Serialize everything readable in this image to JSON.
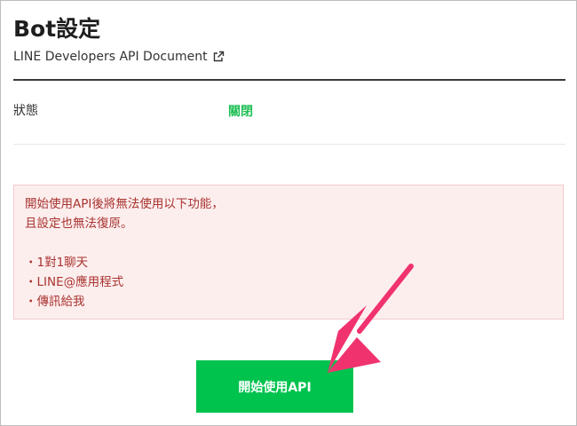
{
  "header": {
    "title": "Bot設定",
    "doc_link_label": "LINE Developers API Document",
    "doc_link_icon": "external-link-icon"
  },
  "status": {
    "label": "狀態",
    "value": "關閉",
    "value_color": "#1fbf55"
  },
  "warning": {
    "line1": "開始使用API後將無法使用以下功能，",
    "line2": "且設定也無法復原。",
    "items": [
      "1對1聊天",
      "LINE@應用程式",
      "傳訊給我"
    ],
    "text_color": "#a8332f",
    "background_color": "#fdeeee"
  },
  "action": {
    "start_api_label": "開始使用API",
    "button_color": "#00c34e"
  },
  "annotation": {
    "arrow_color": "#f0336e",
    "arrow_icon": "pointer-arrow-icon"
  }
}
